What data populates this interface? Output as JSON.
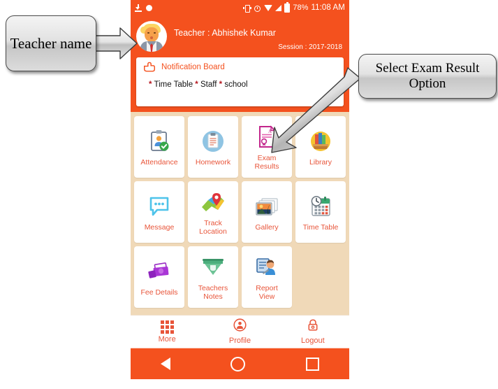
{
  "statusbar": {
    "icons": [
      "download-icon",
      "record-dot-icon",
      "vibrate-icon",
      "alarm-icon",
      "wifi-icon",
      "signal-icon",
      "battery-icon"
    ],
    "battery": "78%",
    "time": "11:08 AM"
  },
  "header": {
    "avatar_icon": "teacher-avatar",
    "teacher_label": "Teacher : Abhishek Kumar",
    "session_label": "Session : 2017-2018"
  },
  "notification": {
    "icon": "pointing-hand-icon",
    "title": "Notification Board",
    "items_prefix": "*",
    "item1": "Time Table",
    "item2": "Staff",
    "item3": "school"
  },
  "grid": {
    "rows": [
      [
        {
          "label": "Attendance",
          "icon": "clipboard-check-icon"
        },
        {
          "label": "Homework",
          "icon": "clipboard-blue-icon"
        },
        {
          "label": "Exam Results",
          "icon": "grade-document-icon"
        },
        {
          "label": "Library",
          "icon": "books-icon"
        }
      ],
      [
        {
          "label": "Message",
          "icon": "chat-bubble-icon"
        },
        {
          "label": "Track Location",
          "icon": "map-pin-icon"
        },
        {
          "label": "Gallery",
          "icon": "photos-icon"
        },
        {
          "label": "Time Table",
          "icon": "calendar-clock-icon"
        }
      ],
      [
        {
          "label": "Fee Details",
          "icon": "money-icon"
        },
        {
          "label": "Teachers Notes",
          "icon": "notes-icon"
        },
        {
          "label": "Report View",
          "icon": "report-person-icon"
        },
        {
          "label": "",
          "icon": ""
        }
      ]
    ]
  },
  "bottomnav": [
    {
      "label": "More",
      "icon": "grid-icon"
    },
    {
      "label": "Profile",
      "icon": "person-circle-icon"
    },
    {
      "label": "Logout",
      "icon": "lock-icon"
    }
  ],
  "androidbar": [
    {
      "icon": "back-triangle-icon"
    },
    {
      "icon": "home-circle-icon"
    },
    {
      "icon": "recents-square-icon"
    }
  ],
  "annotations": {
    "teacher_callout": "Teacher name",
    "exam_callout": "Select Exam Result Option"
  },
  "colors": {
    "accent": "#f4511e",
    "tile_background": "#f0d9b8",
    "label": "#e8553a",
    "asterisk": "#b5171f"
  }
}
